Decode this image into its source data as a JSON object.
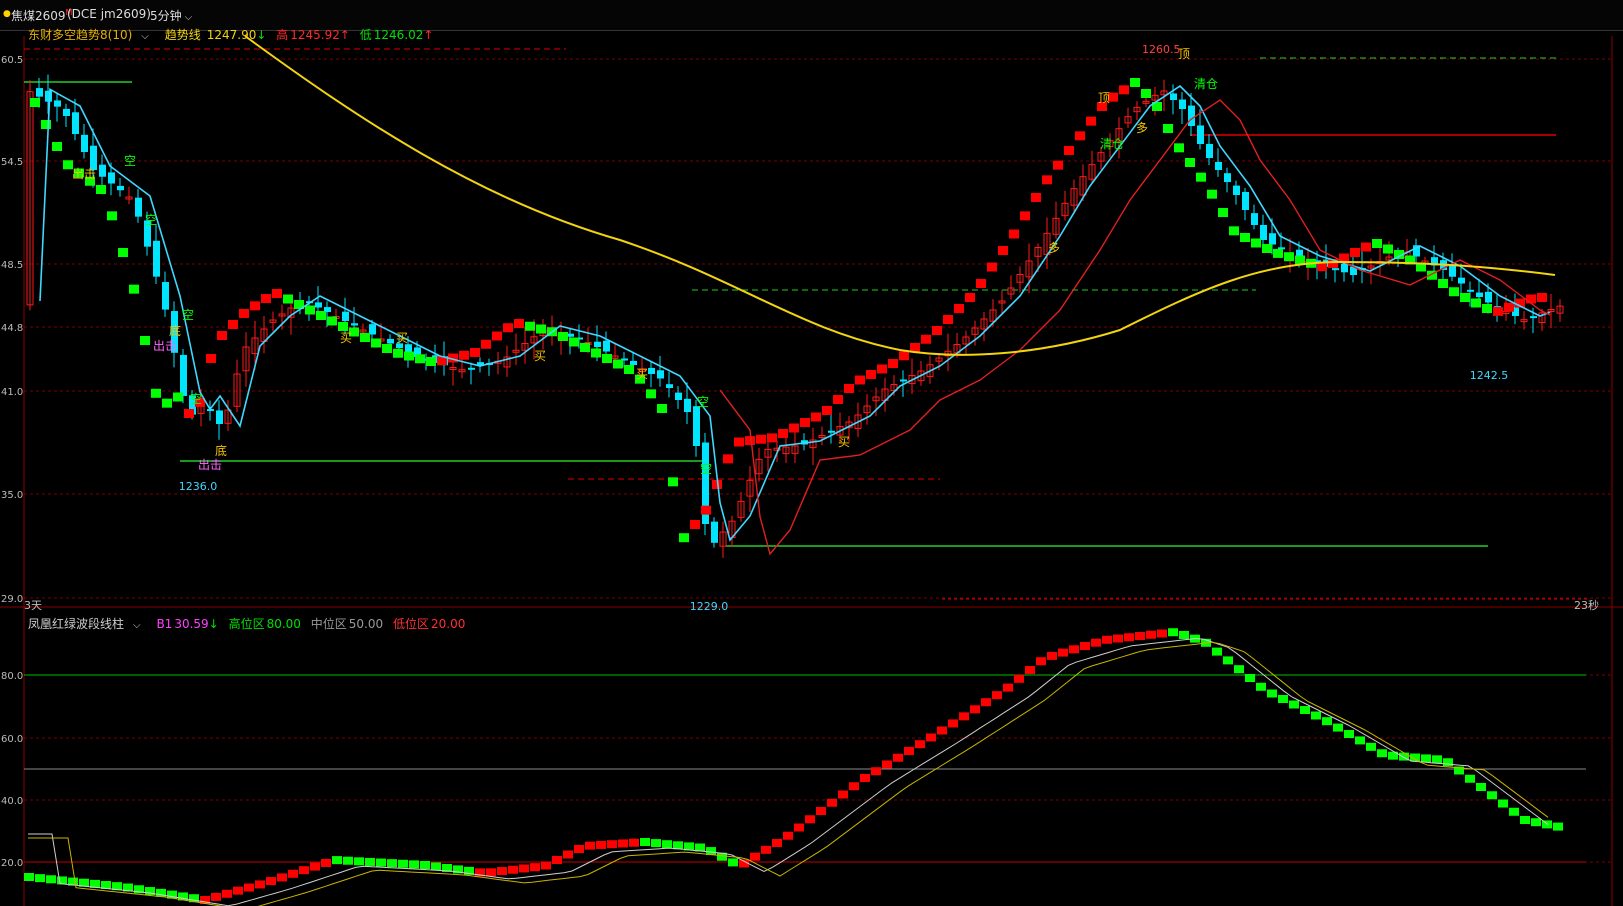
{
  "header": {
    "symbol": "焦煤2609",
    "symbol_sup": "M",
    "exchange_code": "(DCE  jm2609)",
    "period": "5分钟"
  },
  "main_indicator": {
    "name": "东财多空趋势8(10)",
    "trend_label": "趋势线",
    "trend_value": "1247.90",
    "trend_arrow": "↓",
    "high_label": "高",
    "high_value": "1245.92",
    "high_arrow": "↑",
    "low_label": "低",
    "low_value": "1246.02",
    "low_arrow": "↑"
  },
  "sub_indicator": {
    "name": "凤凰红绿波段线柱",
    "b1_label": "B1",
    "b1_value": "30.59",
    "b1_arrow": "↓",
    "high_zone_label": "高位区",
    "high_zone_value": "80.00",
    "mid_zone_label": "中位区",
    "mid_zone_value": "50.00",
    "low_zone_label": "低位区",
    "low_zone_value": "20.00"
  },
  "axis": {
    "main_ticks": [
      "60.5",
      "54.5",
      "48.5",
      "44.8",
      "41.0",
      "35.0",
      "29.0"
    ],
    "sub_ticks": [
      "80.0",
      "60.0",
      "40.0",
      "20.0"
    ],
    "left_footer": "3天",
    "right_footer": "23秒"
  },
  "annotations": {
    "price_high": "1260.5",
    "price_low_1": "1236.0",
    "price_low_2": "1229.0",
    "price_recent_low": "1242.5"
  },
  "signals": {
    "sell": "空",
    "buy": "买",
    "bottom": "底",
    "strike": "出击",
    "top": "顶",
    "clear": "清仓",
    "long": "多"
  },
  "colors": {
    "background": "#000000",
    "bull": "#ff1a1a",
    "bear": "#00e5ff",
    "wave_red": "#ff0000",
    "wave_green": "#00ff00",
    "trend_yellow": "#f2d40f",
    "fast_cyan": "#3fd8ff",
    "slow_red": "#e02020",
    "grid": "#7a0000",
    "label_yellow": "#f5c400"
  }
}
